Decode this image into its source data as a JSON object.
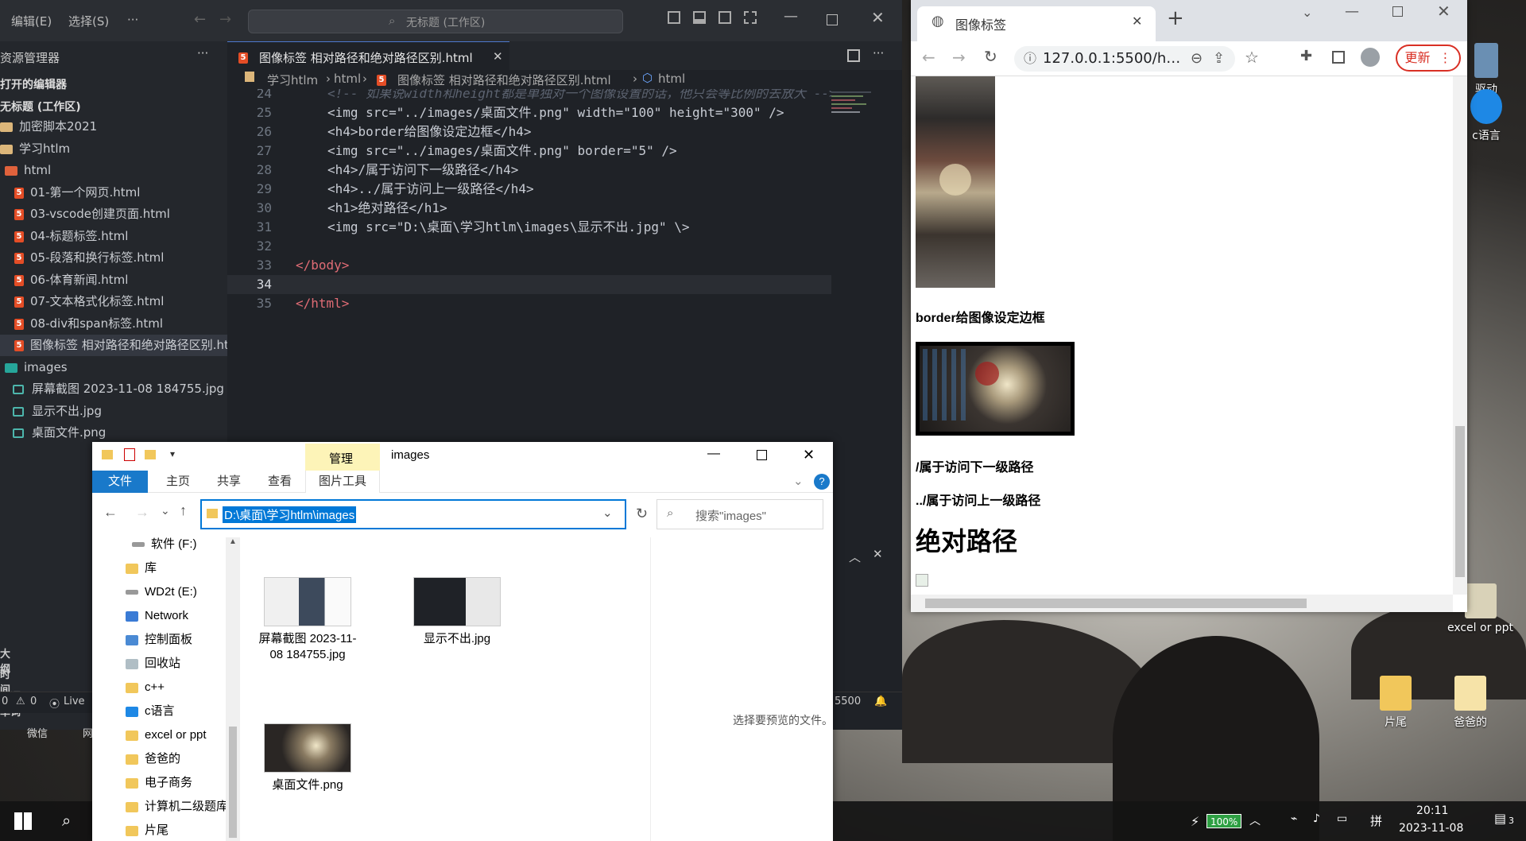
{
  "colors": {
    "vscode_bg": "#1f2227",
    "vscode_sidebar": "#24272c",
    "html_icon": "#e44d26",
    "accent_blue": "#0078d7",
    "chrome_update_red": "#d93025",
    "battery_green": "#2ea043"
  },
  "vscode": {
    "menu": {
      "edit": "编辑(E)",
      "select": "选择(S)",
      "more": "···"
    },
    "command_center": "无标题 (工作区)",
    "sidebar": {
      "title": "资源管理器",
      "sections": {
        "open_editors": "打开的编辑器",
        "workspace": "无标题 (工作区)"
      },
      "items": [
        {
          "label": "加密脚本2021",
          "type": "folder"
        },
        {
          "label": "学习htlm",
          "type": "folder"
        },
        {
          "label": "html",
          "type": "folder"
        },
        {
          "label": "01-第一个网页.html",
          "type": "html"
        },
        {
          "label": "03-vscode创建页面.html",
          "type": "html"
        },
        {
          "label": "04-标题标签.html",
          "type": "html"
        },
        {
          "label": "05-段落和换行标签.html",
          "type": "html"
        },
        {
          "label": "06-体育新闻.html",
          "type": "html"
        },
        {
          "label": "07-文本格式化标签.html",
          "type": "html"
        },
        {
          "label": "08-div和span标签.html",
          "type": "html"
        },
        {
          "label": "图像标签 相对路径和绝对路径区别.html",
          "type": "html"
        },
        {
          "label": "images",
          "type": "folder-img"
        },
        {
          "label": "屏幕截图 2023-11-08 184755.jpg",
          "type": "image"
        },
        {
          "label": "显示不出.jpg",
          "type": "image"
        },
        {
          "label": "桌面文件.png",
          "type": "image"
        }
      ],
      "footer": {
        "outline": "大纲",
        "timeline": "时间线",
        "words": "英语单词"
      }
    },
    "tab": {
      "label": "图像标签 相对路径和绝对路径区别.html",
      "close": "✕"
    },
    "breadcrumb": {
      "b1": "学习htlm",
      "b2": "html",
      "b3": "图像标签 相对路径和绝对路径区别.html",
      "b4": "html"
    },
    "code": [
      {
        "n": "24",
        "text": "<!-- 如果说width和height都是单独对一个图像设置的话，他只会等比例的去放大 -->"
      },
      {
        "n": "25",
        "text": "<img src=\"../images/桌面文件.png\" width=\"100\" height=\"300\" />"
      },
      {
        "n": "26",
        "text": "<h4>border给图像设定边框</h4>"
      },
      {
        "n": "27",
        "text": "<img src=\"../images/桌面文件.png\" border=\"5\" />"
      },
      {
        "n": "28",
        "text": "<h4>/属于访问下一级路径</h4>"
      },
      {
        "n": "29",
        "text": "<h4>../属于访问上一级路径</h4>"
      },
      {
        "n": "30",
        "text": "<h1>绝对路径</h1>"
      },
      {
        "n": "31",
        "text": "<img src=\"D:\\桌面\\学习htlm\\images\\显示不出.jpg\" \\>"
      },
      {
        "n": "32",
        "text": ""
      },
      {
        "n": "33",
        "text": "</body>"
      },
      {
        "n": "34",
        "text": ""
      },
      {
        "n": "35",
        "text": "</html>"
      }
    ],
    "status": {
      "errors": "0",
      "warnings": "0",
      "live": "Live",
      "port": "5500"
    }
  },
  "chrome": {
    "tab_title": "图像标签",
    "tab_close": "✕",
    "new_tab": "+",
    "url": "127.0.0.1:5500/htm...",
    "update_label": "更新",
    "page": {
      "h4_border": "border给图像设定边框",
      "h4_sub": "/属于访问下一级路径",
      "h4_parent": "../属于访问上一级路径",
      "h1_abs": "绝对路径"
    }
  },
  "explorer": {
    "title": "images",
    "manage_tab": "管理",
    "ribbon": {
      "file": "文件",
      "home": "主页",
      "share": "共享",
      "view": "查看",
      "picture_tools": "图片工具"
    },
    "address": "D:\\桌面\\学习htlm\\images",
    "search_placeholder": "搜索\"images\"",
    "nav": [
      {
        "label": "软件 (F:)",
        "icon": "drive"
      },
      {
        "label": "库",
        "icon": "library"
      },
      {
        "label": "WD2t (E:)",
        "icon": "drive"
      },
      {
        "label": "Network",
        "icon": "network"
      },
      {
        "label": "控制面板",
        "icon": "control-panel"
      },
      {
        "label": "回收站",
        "icon": "recycle-bin"
      },
      {
        "label": "c++",
        "icon": "folder"
      },
      {
        "label": "c语言",
        "icon": "gear"
      },
      {
        "label": "excel or ppt",
        "icon": "folder"
      },
      {
        "label": "爸爸的",
        "icon": "folder"
      },
      {
        "label": "电子商务",
        "icon": "folder"
      },
      {
        "label": "计算机二级题库",
        "icon": "folder"
      },
      {
        "label": "片尾",
        "icon": "folder"
      }
    ],
    "files": [
      {
        "name": "屏幕截图 2023-11-08 184755.jpg"
      },
      {
        "name": "显示不出.jpg"
      },
      {
        "name": "桌面文件.png"
      }
    ],
    "preview_text": "选择要预览的文件。"
  },
  "desktop": {
    "icons": [
      {
        "label": "驱动"
      },
      {
        "label": "c语言"
      },
      {
        "label": "excel or ppt"
      },
      {
        "label": "片尾"
      },
      {
        "label": "爸爸的"
      }
    ],
    "taskbar_left_items": {
      "wechat": "微信",
      "net": "网"
    }
  },
  "taskbar": {
    "battery": "100%",
    "ime": "拼",
    "time": "20:11",
    "date": "2023-11-08",
    "notifications": "3"
  }
}
